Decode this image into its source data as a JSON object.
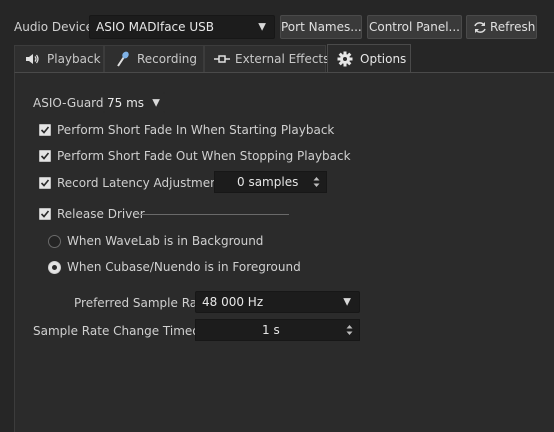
{
  "top": {
    "device_label": "Audio Device",
    "device_value": "ASIO MADIface USB",
    "port_names_label": "Port Names...",
    "control_panel_label": "Control Panel...",
    "refresh_label": "Refresh"
  },
  "tabs": [
    {
      "label": "Playback",
      "icon": "speaker-icon"
    },
    {
      "label": "Recording",
      "icon": "microphone-icon"
    },
    {
      "label": "External Effects",
      "icon": "external-effects-icon"
    },
    {
      "label": "Options",
      "icon": "gear-icon",
      "active": true
    }
  ],
  "options": {
    "asio_guard_label": "ASIO-Guard",
    "asio_guard_value": "75 ms",
    "fade_in_label": "Perform Short Fade In When Starting Playback",
    "fade_in_checked": true,
    "fade_out_label": "Perform Short Fade Out When Stopping Playback",
    "fade_out_checked": true,
    "latency_label": "Record Latency Adjustment",
    "latency_checked": true,
    "latency_value": "0 samples",
    "release_driver_label": "Release Driver",
    "release_driver_checked": true,
    "radio_background_label": "When WaveLab is in Background",
    "radio_background_selected": false,
    "radio_foreground_label": "When Cubase/Nuendo is in Foreground",
    "radio_foreground_selected": true,
    "preferred_rate_label": "Preferred Sample Rate",
    "preferred_rate_value": "48 000 Hz",
    "rate_timeout_label": "Sample Rate Change Timeout",
    "rate_timeout_value": "1 s"
  },
  "colors": {
    "background": "#262626",
    "panel": "#2b2b2b",
    "field": "#1c1c1c"
  }
}
